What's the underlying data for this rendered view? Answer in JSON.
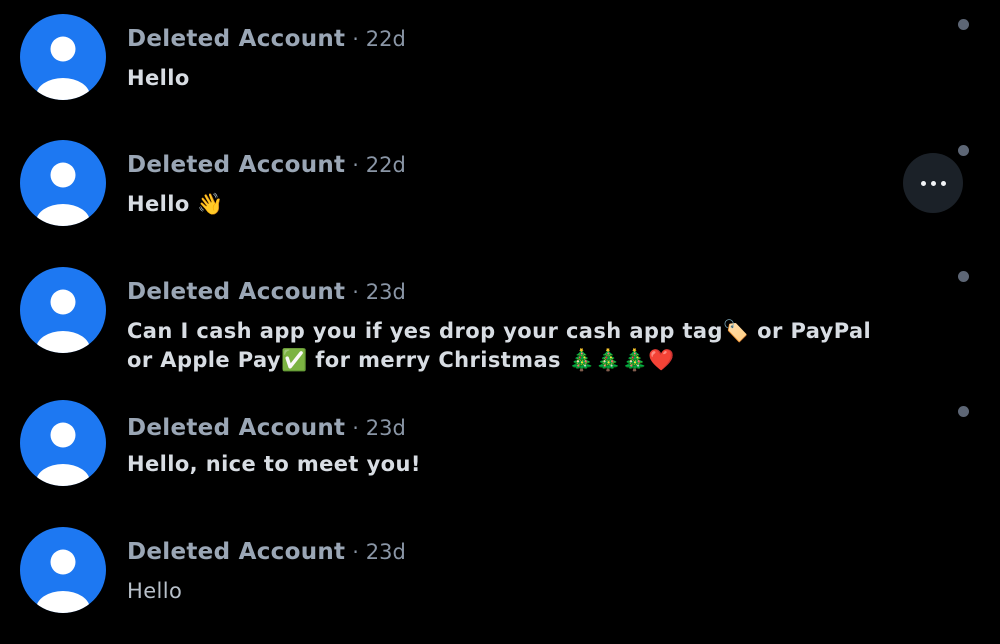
{
  "messages": [
    {
      "sender": "Deleted Account",
      "separator": "·",
      "time": "22d",
      "text": "Hello"
    },
    {
      "sender": "Deleted Account",
      "separator": "·",
      "time": "22d",
      "text": "Hello 👋"
    },
    {
      "sender": "Deleted Account",
      "separator": "·",
      "time": "23d",
      "text": "Can I cash app you if yes drop your cash app tag🏷️ or PayPal or Apple Pay✅ for merry Christmas 🎄🎄🎄❤️"
    },
    {
      "sender": "Deleted Account",
      "separator": "·",
      "time": "23d",
      "text": "Hello, nice to meet you!"
    },
    {
      "sender": "Deleted Account",
      "separator": "·",
      "time": "23d",
      "text": "Hello"
    }
  ],
  "icons": {
    "avatar": "default-user-avatar-icon",
    "more_button": "more-horizontal-icon",
    "unread_indicator": "unread-dot-icon"
  },
  "colors": {
    "background": "#000000",
    "avatar_blue": "#1d78f2",
    "sender_text": "#9aa6b5",
    "message_text": "#d8dde3",
    "unread_dot": "#5d6675",
    "more_button_bg": "#1b2128"
  }
}
